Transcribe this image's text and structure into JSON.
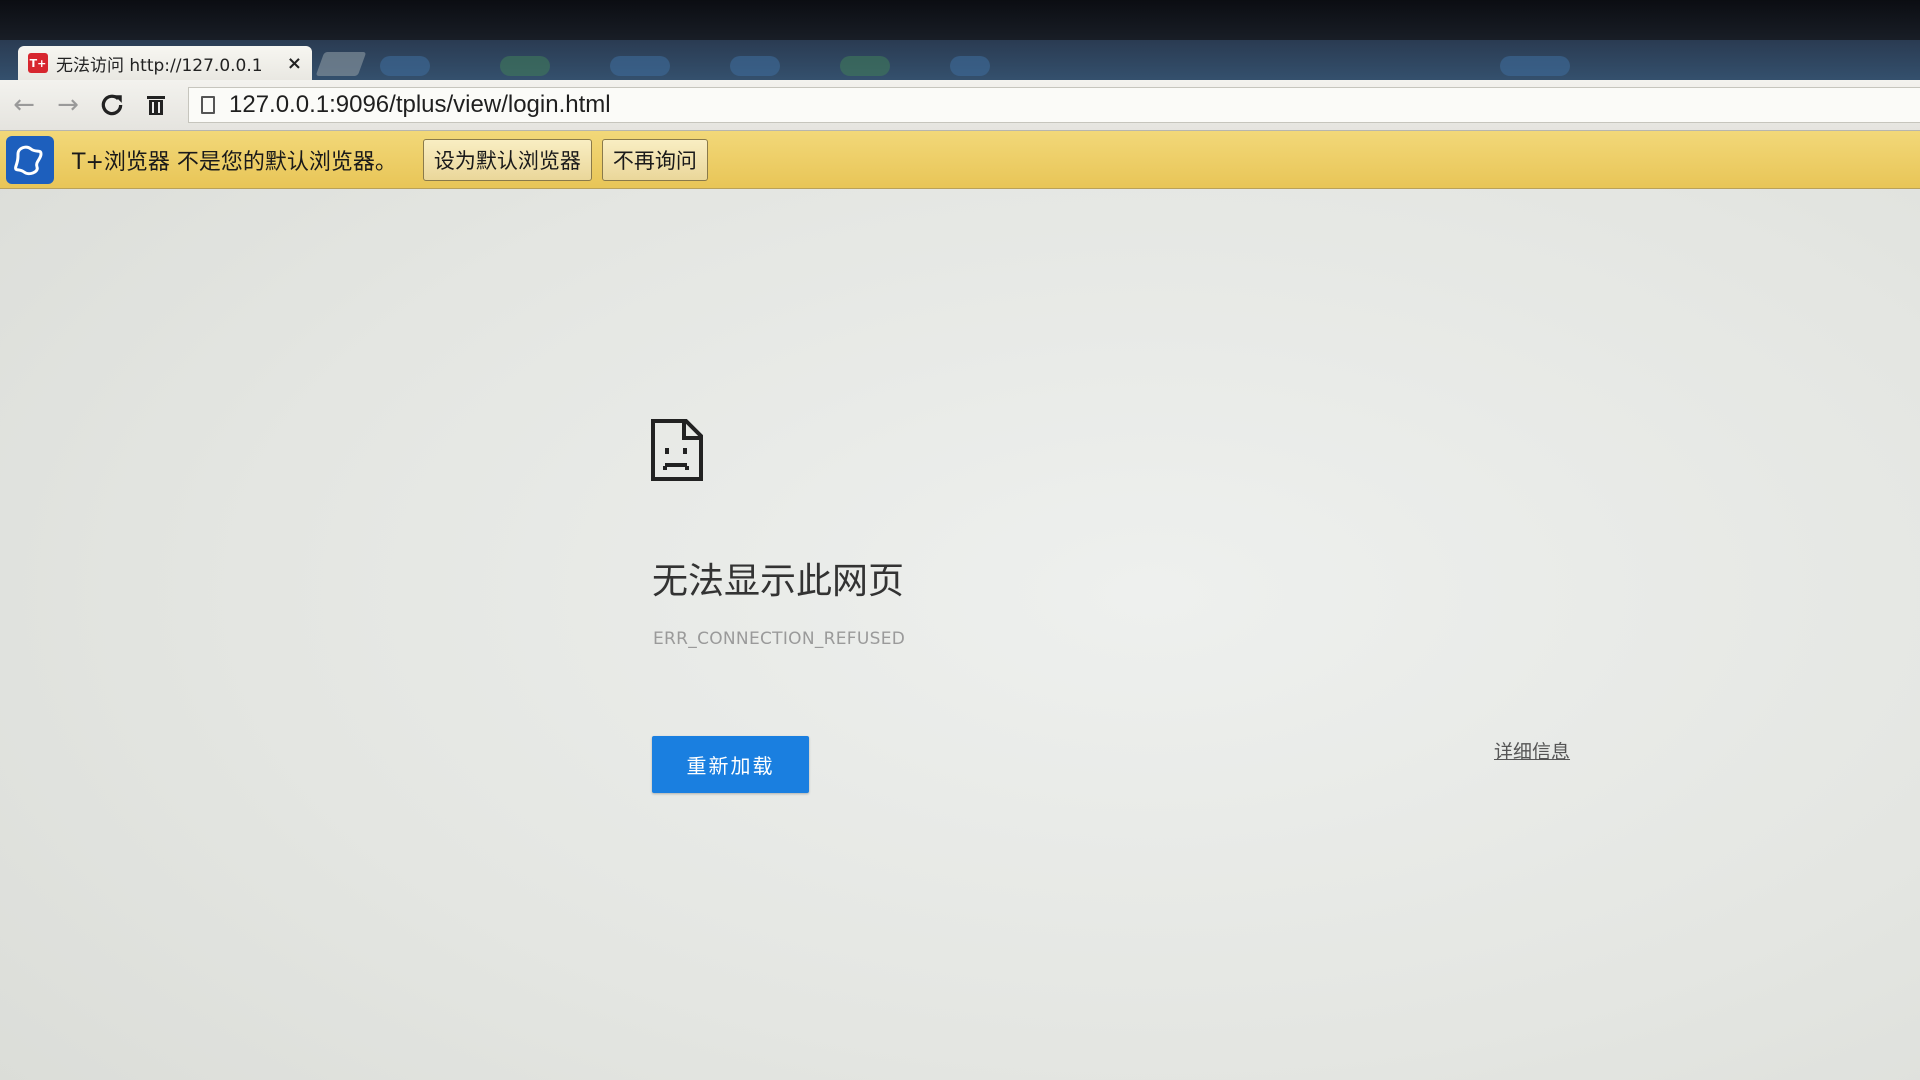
{
  "tab": {
    "favicon_text": "T+",
    "title": "无法访问 http://127.0.0.1",
    "close": "×"
  },
  "toolbar": {
    "back": "←",
    "forward": "→",
    "reload": "C",
    "clear": "🗑",
    "url": "127.0.0.1:9096/tplus/view/login.html"
  },
  "infobar": {
    "message": "T+浏览器 不是您的默认浏览器。",
    "set_default_label": "设为默认浏览器",
    "dont_ask_label": "不再询问"
  },
  "error": {
    "title": "无法显示此网页",
    "code": "ERR_CONNECTION_REFUSED",
    "reload_label": "重新加载",
    "details_label": "详细信息"
  },
  "colors": {
    "reload_button": "#1a7fe0",
    "infobar": "#ecce67",
    "favicon": "#d7262e"
  }
}
